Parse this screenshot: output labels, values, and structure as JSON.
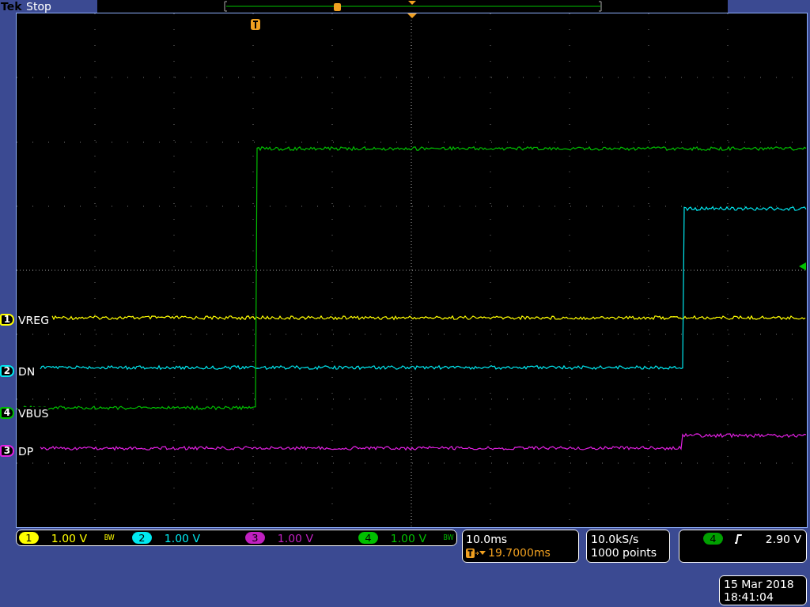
{
  "status_bar": {
    "brand": "Tek",
    "acquisition_state": "Stop"
  },
  "traces": [
    {
      "number": "1",
      "label": "VREG",
      "color": "#ffff00"
    },
    {
      "number": "2",
      "label": "DN",
      "color": "#00e8f0"
    },
    {
      "number": "4",
      "label": "VBUS",
      "color": "#00c000"
    },
    {
      "number": "3",
      "label": "DP",
      "color": "#e020e0"
    }
  ],
  "readout": [
    {
      "number": "1",
      "scale": "1.00 V",
      "bw": "BW",
      "color": "#ffff00"
    },
    {
      "number": "2",
      "scale": "1.00 V",
      "color": "#00e8f0"
    },
    {
      "number": "3",
      "scale": "1.00 V",
      "color": "#c020c0"
    },
    {
      "number": "4",
      "scale": "1.00 V",
      "bw": "BW",
      "color": "#00c000"
    }
  ],
  "horizontal": {
    "scale": "10.0ms",
    "trigger_position": "19.7000ms"
  },
  "acquisition": {
    "sample_rate": "10.0kS/s",
    "record_length": "1000 points"
  },
  "trigger": {
    "source": "4",
    "level": "2.90 V"
  },
  "datetime": {
    "date": "15 Mar 2018",
    "time": "18:41:04"
  }
}
